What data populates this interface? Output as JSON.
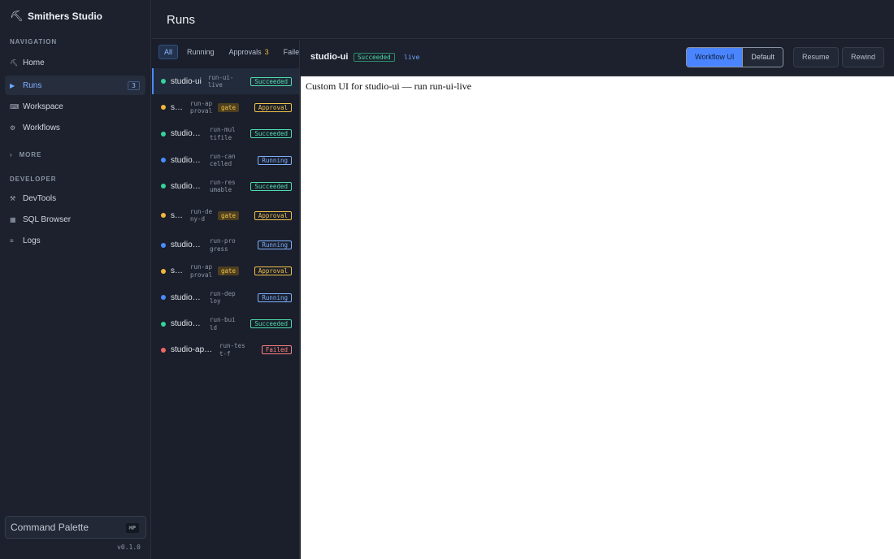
{
  "app": {
    "title": "Smithers Studio",
    "version": "v0.1.0"
  },
  "sidebar": {
    "navigation_label": "NAVIGATION",
    "nav": [
      {
        "label": "Home",
        "icon": "hammer-icon"
      },
      {
        "label": "Runs",
        "icon": "play-icon",
        "count": "3",
        "active": true
      },
      {
        "label": "Workspace",
        "icon": "code-icon"
      },
      {
        "label": "Workflows",
        "icon": "gear-icon"
      }
    ],
    "more_label": "MORE",
    "developer_label": "DEVELOPER",
    "developer": [
      {
        "label": "DevTools",
        "icon": "tools-icon"
      },
      {
        "label": "SQL Browser",
        "icon": "grid-icon"
      },
      {
        "label": "Logs",
        "icon": "list-icon"
      }
    ],
    "command_palette": {
      "label": "Command Palette",
      "shortcut": "⌘P"
    }
  },
  "header": {
    "title": "Runs"
  },
  "filters": [
    {
      "label": "All",
      "active": true
    },
    {
      "label": "Running"
    },
    {
      "label": "Approvals",
      "badge": "3"
    },
    {
      "label": "Failed"
    }
  ],
  "runs": [
    {
      "name": "studio-ui",
      "id": "run-ui-live",
      "status": "Succeeded",
      "state": "succeeded",
      "selected": true
    },
    {
      "name": "studio-approval",
      "id": "run-approval",
      "gate": "gate",
      "status": "Approval",
      "state": "approval"
    },
    {
      "name": "studio-multifile",
      "id": "run-multifile",
      "status": "Succeeded",
      "state": "succeeded"
    },
    {
      "name": "studio-long",
      "id": "run-cancelled",
      "status": "Running",
      "state": "running"
    },
    {
      "name": "studio-resume",
      "id": "run-resumable",
      "status": "Succeeded",
      "state": "succeeded"
    },
    {
      "name": "studio-deny",
      "id": "run-deny-d",
      "gate": "gate",
      "status": "Approval",
      "state": "approval",
      "tall": true
    },
    {
      "name": "studio-progress",
      "id": "run-progress",
      "status": "Running",
      "state": "running"
    },
    {
      "name": "studio-approval",
      "id": "run-approval",
      "gate": "gate",
      "status": "Approval",
      "state": "approval"
    },
    {
      "name": "studio-app-deploy",
      "id": "run-deploy",
      "status": "Running",
      "state": "running"
    },
    {
      "name": "studio-app-build",
      "id": "run-build",
      "status": "Succeeded",
      "state": "succeeded"
    },
    {
      "name": "studio-app-test",
      "id": "run-test-f",
      "status": "Failed",
      "state": "failed"
    }
  ],
  "colors": {
    "succeeded": "#34d399",
    "running": "#4a8cff",
    "approval": "#f2b73a",
    "failed": "#f06565"
  },
  "detail": {
    "name": "studio-ui",
    "status": "Succeeded",
    "live": "live",
    "view_options": [
      {
        "label": "Workflow UI",
        "active": true
      },
      {
        "label": "Default"
      }
    ],
    "resume_label": "Resume",
    "rewind_label": "Rewind",
    "custom_ui_text": "Custom UI for studio-ui — run run-ui-live"
  }
}
